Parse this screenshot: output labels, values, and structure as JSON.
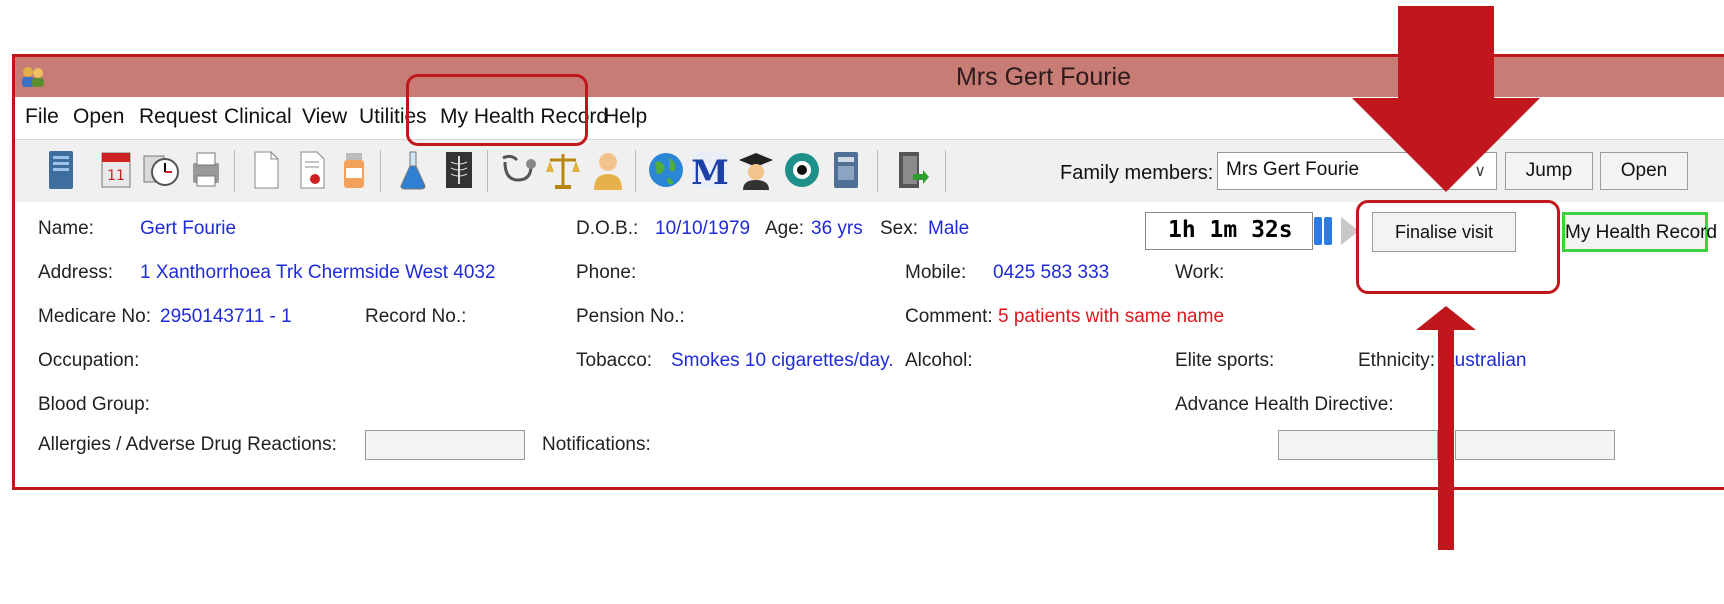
{
  "window": {
    "title": "Mrs Gert Fourie"
  },
  "menu": [
    "File",
    "Open",
    "Request",
    "Clinical",
    "View",
    "Utilities",
    "My Health Record",
    "Help"
  ],
  "toolbar": {
    "icons": [
      "server-icon",
      "calendar-icon",
      "clock-icon",
      "printer-icon",
      "document-icon",
      "certificate-icon",
      "pill-bottle-icon",
      "flask-icon",
      "xray-icon",
      "stethoscope-icon",
      "scales-icon",
      "person-icon",
      "globe-icon",
      "m-icon",
      "graduate-icon",
      "eye-icon",
      "book-icon",
      "exit-door-icon"
    ],
    "family_label": "Family members:",
    "family_value": "Mrs Gert Fourie",
    "jump_label": "Jump",
    "open_label": "Open"
  },
  "patient": {
    "name_label": "Name:",
    "name": "Gert Fourie",
    "dob_label": "D.O.B.:",
    "dob": "10/10/1979",
    "age_label": "Age:",
    "age": "36 yrs",
    "sex_label": "Sex:",
    "sex": "Male",
    "address_label": "Address:",
    "address": "1 Xanthorrhoea Trk  Chermside West  4032",
    "phone_label": "Phone:",
    "mobile_label": "Mobile:",
    "mobile": "0425 583 333",
    "work_label": "Work:",
    "medicare_label": "Medicare No:",
    "medicare": "2950143711 - 1",
    "record_label": "Record No.:",
    "pension_label": "Pension No.:",
    "comment_label": "Comment:",
    "comment": "5 patients with same name",
    "occupation_label": "Occupation:",
    "tobacco_label": "Tobacco:",
    "tobacco": "Smokes 10 cigarettes/day.",
    "alcohol_label": "Alcohol:",
    "elite_label": "Elite sports:",
    "ethnicity_label": "Ethnicity:",
    "ethnicity": "Australian",
    "blood_label": "Blood Group:",
    "ahd_label": "Advance Health Directive:",
    "allergies_label": "Allergies / Adverse Drug Reactions:",
    "notifications_label": "Notifications:"
  },
  "visit": {
    "timer": "1h 1m  32s",
    "finalise_label": "Finalise visit",
    "mhr_button_label": "My Health Record"
  },
  "colors": {
    "accent": "#c0171c",
    "title_bar": "#c87c76",
    "link_blue": "#1f2bd8",
    "warning_red": "#e0161b",
    "mhr_border": "#3fcf3f"
  }
}
